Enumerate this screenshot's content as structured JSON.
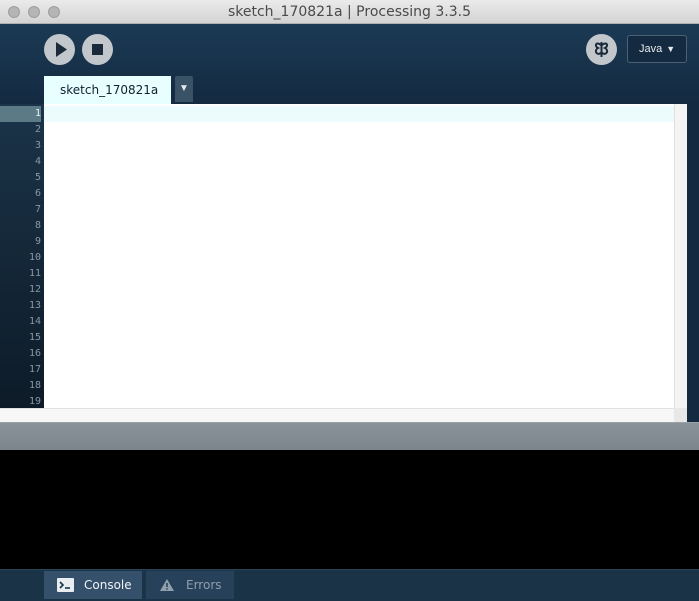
{
  "window": {
    "title": "sketch_170821a | Processing 3.3.5"
  },
  "toolbar": {
    "mode_label": "Java",
    "mode_caret": "▼"
  },
  "tabs": [
    {
      "label": "sketch_170821a"
    }
  ],
  "tab_menu_glyph": "▼",
  "editor": {
    "line_numbers": [
      "1",
      "2",
      "3",
      "4",
      "5",
      "6",
      "7",
      "8",
      "9",
      "10",
      "11",
      "12",
      "13",
      "14",
      "15",
      "16",
      "17",
      "18",
      "19"
    ],
    "current_line": "1"
  },
  "footer": {
    "console_label": "Console",
    "errors_label": "Errors"
  },
  "colors": {
    "toolbar_bg": "#1c3a55",
    "tab_active": "#e8ffff",
    "console_bg": "#000000"
  }
}
